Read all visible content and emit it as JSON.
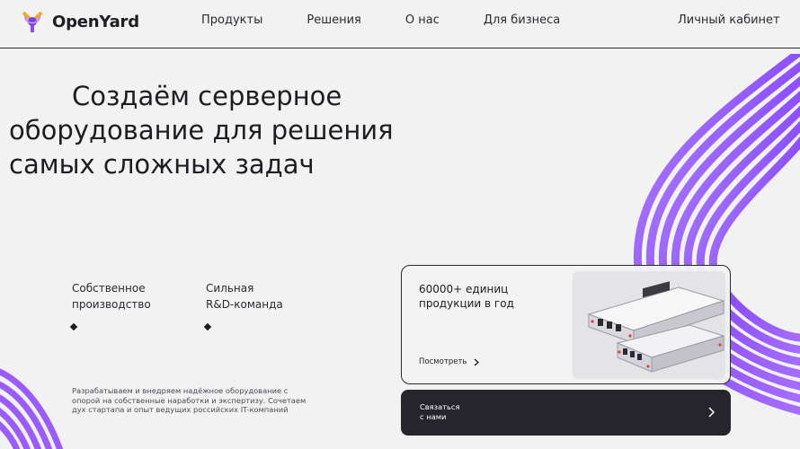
{
  "header": {
    "logo_text": "OpenYard",
    "nav": [
      "Продукты",
      "Решения",
      "О нас",
      "Для бизнеса"
    ],
    "account_label": "Личный кабинет"
  },
  "hero": {
    "title_lines": [
      "Создаём серверное",
      "оборудование для решения",
      "самых сложных задач"
    ]
  },
  "features": [
    {
      "line1": "Собственное",
      "line2": "производство"
    },
    {
      "line1": "Сильная",
      "line2": "R&D-команда"
    }
  ],
  "description": "Разрабатываем и внедряем надёжное оборудование с опорой на собственные наработки и экспертизу. Сочетаем дух стартапа и опыт ведущих российских IT-компаний",
  "product_card": {
    "title_line1": "60000+ единиц",
    "title_line2": "продукции в год",
    "link_label": "Посмотреть"
  },
  "contact": {
    "line1": "Связаться",
    "line2": "с нами"
  },
  "colors": {
    "background": "#f2f2f3",
    "dark": "#25252b",
    "accent_purple": "#8a4dff",
    "logo_orange": "#f5a623"
  },
  "icons": {
    "logo": "openyard-logo-icon",
    "link_arrow": "chevron-right-icon",
    "contact_arrow": "chevron-right-icon"
  }
}
